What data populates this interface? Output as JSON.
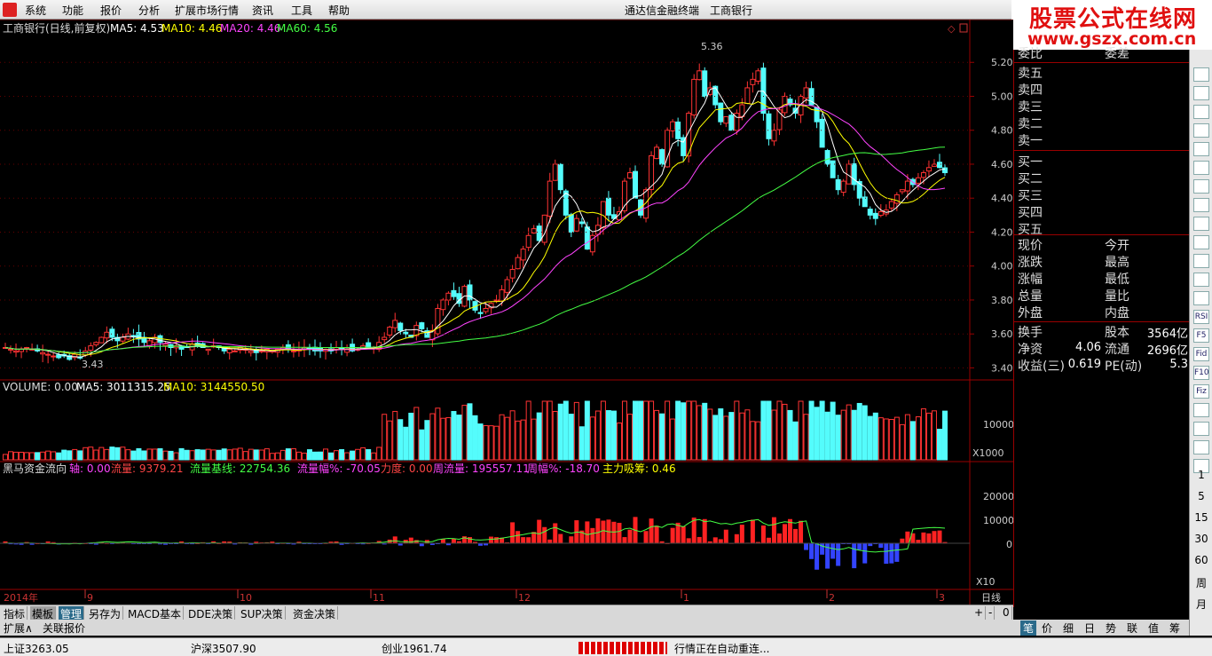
{
  "menu": [
    "系统",
    "功能",
    "报价",
    "分析",
    "扩展市场行情",
    "资讯",
    "工具",
    "帮助"
  ],
  "window_title": "通达信金融终端",
  "stock_title": "工商银行",
  "banner": {
    "line1": "股票公式在线网",
    "line2": "www.gszx.com.cn"
  },
  "chart_header": {
    "name": "工商银行(日线,前复权)",
    "ma5": "MA5: 4.53",
    "ma10": "MA10: 4.46",
    "ma20": "MA20: 4.46",
    "ma60": "MA60: 4.56"
  },
  "price_axis": [
    "5.20",
    "5.00",
    "4.80",
    "4.60",
    "4.40",
    "4.20",
    "4.00",
    "3.80",
    "3.60",
    "3.40"
  ],
  "high_label": "5.36",
  "low_label": "3.43",
  "volume_header": {
    "volume": "VOLUME: 0.00",
    "ma5": "MA5: 3011315.25",
    "ma10": "MA10: 3144550.50"
  },
  "volume_axis": {
    "top": "10000",
    "unit": "X1000"
  },
  "flow_header": {
    "name": "黑马资金流向",
    "axis": "轴: 0.00",
    "flow": "流量: 9379.21",
    "base": "流量基线: 22754.36",
    "flow_pct": "流量幅%: -70.05",
    "force": "力度: 0.00",
    "week_flow": "周流量: 195557.11",
    "week_pct": "周幅%: -18.70",
    "main": "主力吸筹: 0.46"
  },
  "flow_axis": [
    "20000",
    "10000",
    "0"
  ],
  "flow_unit": "X10",
  "date_axis": {
    "year": "2014年",
    "months": [
      "9",
      "10",
      "11",
      "12",
      "1",
      "2",
      "3"
    ],
    "period": "日线"
  },
  "chart_data": {
    "type": "candlestick",
    "title": "工商银行(日线,前复权)",
    "ylim": [
      3.35,
      5.4
    ],
    "price_range": {
      "low": 3.43,
      "high": 5.36
    },
    "ma_latest": {
      "MA5": 4.53,
      "MA10": 4.46,
      "MA20": 4.46,
      "MA60": 4.56
    },
    "closes": [
      3.52,
      3.51,
      3.5,
      3.51,
      3.52,
      3.51,
      3.5,
      3.49,
      3.48,
      3.47,
      3.46,
      3.47,
      3.45,
      3.48,
      3.46,
      3.5,
      3.53,
      3.55,
      3.58,
      3.61,
      3.58,
      3.56,
      3.58,
      3.6,
      3.59,
      3.57,
      3.55,
      3.56,
      3.58,
      3.55,
      3.54,
      3.52,
      3.53,
      3.51,
      3.52,
      3.54,
      3.53,
      3.52,
      3.51,
      3.53,
      3.52,
      3.5,
      3.51,
      3.5,
      3.52,
      3.51,
      3.5,
      3.49,
      3.5,
      3.51,
      3.5,
      3.51,
      3.52,
      3.51,
      3.5,
      3.51,
      3.52,
      3.51,
      3.5,
      3.5,
      3.51,
      3.5,
      3.52,
      3.51,
      3.52,
      3.5,
      3.51,
      3.53,
      3.52,
      3.52,
      3.55,
      3.58,
      3.64,
      3.68,
      3.62,
      3.6,
      3.58,
      3.65,
      3.63,
      3.58,
      3.62,
      3.75,
      3.8,
      3.84,
      3.82,
      3.78,
      3.88,
      3.8,
      3.74,
      3.72,
      3.75,
      3.78,
      3.8,
      3.86,
      3.92,
      3.98,
      4.05,
      4.1,
      4.18,
      4.22,
      4.15,
      4.3,
      4.5,
      4.6,
      4.45,
      4.3,
      4.2,
      4.28,
      4.25,
      4.1,
      4.18,
      4.24,
      4.38,
      4.3,
      4.28,
      4.32,
      4.5,
      4.55,
      4.4,
      4.3,
      4.45,
      4.65,
      4.7,
      4.6,
      4.8,
      4.85,
      4.75,
      4.65,
      4.9,
      5.1,
      5.15,
      5.0,
      5.05,
      4.95,
      4.85,
      4.88,
      4.8,
      4.9,
      4.95,
      5.05,
      5.1,
      5.15,
      4.9,
      4.75,
      4.8,
      4.92,
      5.0,
      4.95,
      4.9,
      5.0,
      5.05,
      4.95,
      4.85,
      4.7,
      4.6,
      4.52,
      4.45,
      4.5,
      4.6,
      4.48,
      4.4,
      4.35,
      4.3,
      4.28,
      4.32,
      4.33,
      4.38,
      4.42,
      4.45,
      4.5,
      4.48,
      4.52,
      4.55,
      4.58,
      4.6,
      4.58,
      4.55
    ],
    "flow_unit_note": "X10"
  },
  "quote_panel": {
    "top": [
      "委比",
      "委差"
    ],
    "sell": [
      "卖五",
      "卖四",
      "卖三",
      "卖二",
      "卖一"
    ],
    "buy": [
      "买一",
      "买二",
      "买三",
      "买四",
      "买五"
    ],
    "info": [
      [
        "现价",
        "今开"
      ],
      [
        "涨跌",
        "最高"
      ],
      [
        "涨幅",
        "最低"
      ],
      [
        "总量",
        "量比"
      ],
      [
        "外盘",
        "内盘"
      ]
    ],
    "extra": [
      {
        "l1": "换手",
        "v1": "",
        "l2": "股本",
        "v2": "3564亿"
      },
      {
        "l1": "净资",
        "v1": "4.06",
        "l2": "流通",
        "v2": "2696亿"
      },
      {
        "l1": "收益(三)",
        "v1": "0.619",
        "l2": "PE(动)",
        "v2": "5.3"
      }
    ]
  },
  "tool_numbers": [
    "1",
    "5",
    "15",
    "30",
    "60",
    "周",
    "月"
  ],
  "tool_icons": [
    "RSI",
    "F5",
    "Fid",
    "F10",
    "Fiz"
  ],
  "tabs_row1": [
    "指标",
    "模板",
    "管理",
    "另存为",
    "MACD基本",
    "DDE决策",
    "SUP决策",
    "资金决策"
  ],
  "tabs_row1_right": [
    "+",
    "-",
    "0"
  ],
  "tabs_row2": [
    "扩展∧",
    "关联报价"
  ],
  "right_tabs": [
    "笔",
    "价",
    "细",
    "日",
    "势",
    "联",
    "值",
    "筹"
  ],
  "status": {
    "sh": "上证3263.05",
    "hs": "沪深3507.90",
    "cy": "创业1961.74",
    "msg": "行情正在自动重连..."
  }
}
